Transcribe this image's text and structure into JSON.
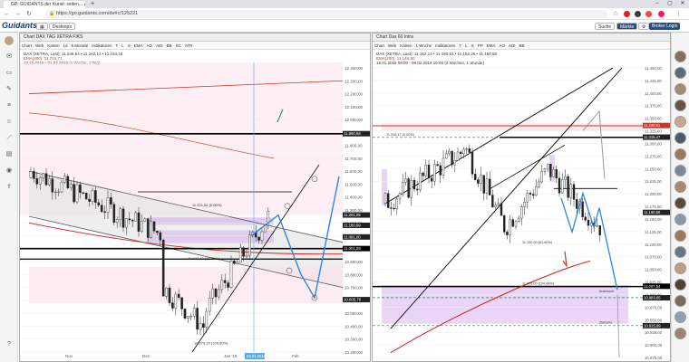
{
  "browser": {
    "tab_title": "GP: GUIDANTS der Kunst: seiten...",
    "url": "https://go.guidants.com/de#c/125221"
  },
  "app": {
    "logo": "Guidants",
    "desktop_button": "Desktops",
    "search_button": "Suche",
    "market_button": "Märkte",
    "broker_button": "Broker Login"
  },
  "left_panel": {
    "title": "Chart DAX TAG XETRA FIKS",
    "toolbar": [
      "Chart",
      "Web",
      "Karten",
      "1d",
      "6 Monate",
      "Indikatoren",
      "T",
      "L",
      "S",
      "EMA",
      "AO",
      "ADI",
      "BB",
      "SC",
      "ATR"
    ],
    "info_line1": "DAX (XETRA, Last): 11.246,64 • 11.162,12 • 11.153,18",
    "info_line2": "EMA(200): 11.713,71",
    "info_line3": "17.10.2018 - 01.02.2019 (1 Woche, 1 Tag)",
    "price_labels": [
      "12.400,00",
      "12.300,00",
      "12.200,00",
      "12.100,00",
      "12.000,00",
      "11.900,00",
      "11.800,00",
      "11.700,00",
      "11.600,00",
      "11.500,00",
      "11.400,00",
      "11.300,00",
      "11.200,00",
      "11.100,00",
      "11.000,00",
      "10.900,00",
      "10.800,00",
      "10.700,00",
      "10.600,00",
      "10.500,00",
      "10.400,00",
      "10.300,00",
      "10.200,00"
    ],
    "highlight_labels": [
      "11.890,58",
      "11.261,05",
      "11.180,99",
      "11.091,00",
      "11.001,28",
      "10.605,76"
    ],
    "x_labels": [
      "Nov",
      "Dez",
      "Jan '19",
      "Feb"
    ],
    "x_highlight": "24.01.2019",
    "annotations": [
      "11.321,52 (0.00%)",
      "10.977,40 (61.80%)",
      "10.279,20 (100.00%)"
    ]
  },
  "right_panel": {
    "title": "Chart Dax 60 Intra",
    "toolbar": [
      "Chart",
      "Web",
      "Karten",
      "1 Woche",
      "Indikatoren",
      "T",
      "L",
      "S",
      "PP",
      "EMA",
      "AO",
      "ADI",
      "BB"
    ],
    "info_line1": "DAX (XETRA, Last): 11.162,14 • 11.180,61 • 11.152,26 • 11.160,58",
    "info_line2": "EMA(200): 11.146,50",
    "info_line3": "18.01.2019 09:00 - 08.02.2019 16:00 (3 Wochen, 1 Stunde)",
    "price_labels": [
      "11.450,00",
      "11.425,00",
      "11.400,00",
      "11.375,00",
      "11.350,00",
      "11.325,00",
      "11.300,00",
      "11.275,00",
      "11.250,00",
      "11.225,00",
      "11.200,00",
      "11.175,00",
      "11.150,00",
      "11.125,00",
      "11.100,00",
      "11.075,00",
      "11.050,00",
      "11.025,00",
      "11.000,00",
      "10.975,00",
      "10.950,00",
      "10.925,00",
      "10.900,00",
      "10.875,00"
    ],
    "highlight_labels": [
      "11.340,61",
      "11.316,47",
      "11.160,58",
      "11.007,54",
      "10.983,65",
      "10.925,89"
    ],
    "annotations": [
      "11.316,47 (0.00%)",
      "11.005,00 (100.00%)",
      "11.100,00 (61.80%)",
      "Ausbruch",
      "Zielzone"
    ]
  },
  "colors": {
    "accent": "#2b4d80",
    "trend_blue": "#2e86de",
    "resistance_red": "#c0392b",
    "ema_red": "#cc2222",
    "zone_pink": "#f4c6d8",
    "zone_violet": "#d7b5ef",
    "support_green": "#1e8449"
  }
}
